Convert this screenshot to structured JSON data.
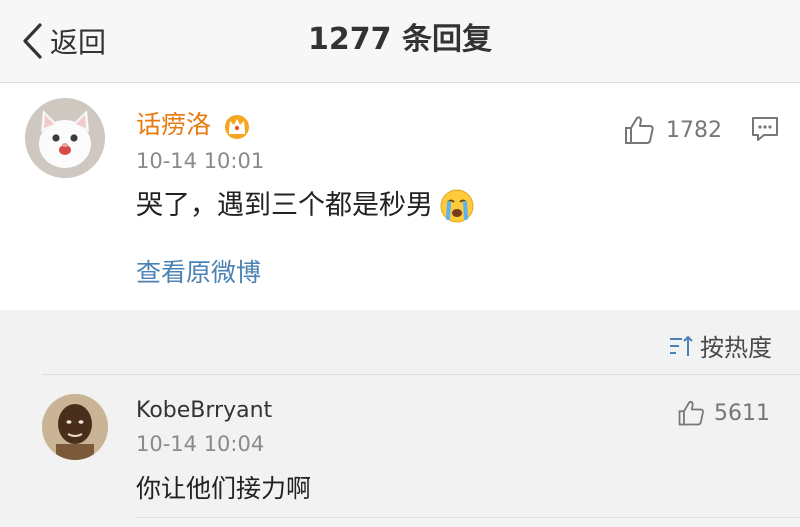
{
  "header": {
    "back_label": "返回",
    "title": "1277 条回复"
  },
  "post": {
    "username": "话痨洛",
    "username_color": "#e8790e",
    "timestamp": "10-14 10:01",
    "content": "哭了，遇到三个都是秒男",
    "view_original": "查看原微博",
    "like_count": "1782",
    "icons": [
      "crown-badge-icon",
      "crying-emoji-icon",
      "thumbs-up-icon",
      "comment-icon"
    ]
  },
  "sort": {
    "label": "按热度"
  },
  "reply": {
    "username": "KobeBrryant",
    "timestamp": "10-14 10:04",
    "content": "你让他们接力啊",
    "like_count": "5611"
  },
  "colors": {
    "link": "#4a82b3",
    "background": "#f2f2f2",
    "card": "#ffffff"
  }
}
